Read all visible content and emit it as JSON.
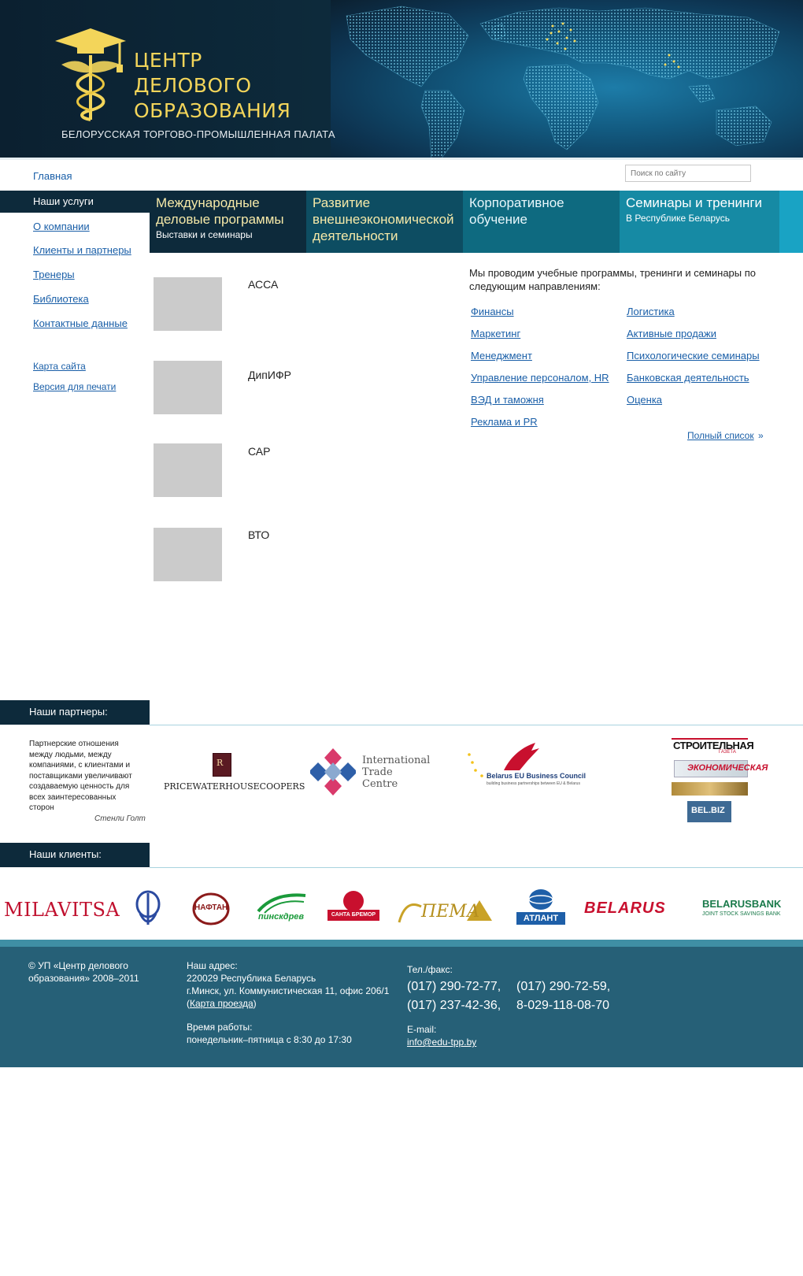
{
  "header": {
    "logo_line1": "ЦЕНТР",
    "logo_line2": "ДЕЛОВОГО",
    "logo_line3": "ОБРАЗОВАНИЯ",
    "subtitle": "БЕЛОРУССКАЯ ТОРГОВО-ПРОМЫШЛЕННАЯ ПАЛАТА"
  },
  "topbar": {
    "home_link": "Главная",
    "search_placeholder": "Поиск по сайту"
  },
  "sidebar": {
    "items": [
      {
        "label": "Наши услуги",
        "active": true
      },
      {
        "label": "О компании"
      },
      {
        "label": "Клиенты и партнеры"
      },
      {
        "label": "Тренеры"
      },
      {
        "label": "Библиотека"
      },
      {
        "label": "Контактные данные"
      }
    ],
    "secondary": [
      {
        "label": "Карта сайта"
      },
      {
        "label": "Версия для печати"
      }
    ]
  },
  "tabs": [
    {
      "title": "Международные деловые программы",
      "subtitle": "Выставки и семинары"
    },
    {
      "title": "Развитие внешнеэкономической деятельности",
      "subtitle": ""
    },
    {
      "title": "Корпоративное обучение",
      "subtitle": ""
    },
    {
      "title": "Семинары и тренинги",
      "subtitle": "В Республике Беларусь"
    }
  ],
  "programs": [
    {
      "label": "АССА"
    },
    {
      "label": "ДипИФР"
    },
    {
      "label": "САР"
    },
    {
      "label": "ВТО"
    }
  ],
  "directions": {
    "intro": "Мы проводим учебные программы, тренинги и семинары по следующим направлениям:",
    "left": [
      "Финансы",
      "Маркетинг",
      "Менеджмент",
      "Управление персоналом, HR",
      "ВЭД и таможня",
      "Реклама и PR"
    ],
    "right": [
      "Логистика",
      "Активные продажи",
      "Психологические семинары",
      "Банковская деятельность",
      "Оценка"
    ],
    "full_list": "Полный список",
    "full_list_arrow": "»"
  },
  "partners": {
    "heading": "Наши партнеры:",
    "quote": "Партнерские отношения между людьми, между компаниями, с клиентами и поставщиками увеличивают создаваемую ценность для всех заинтересованных сторон",
    "quote_author": "Стенли Голт",
    "logos": {
      "pwc": "PRICEWATERHOUSECOOPERS",
      "itc": [
        "International",
        "Trade",
        "Centre"
      ],
      "belarus_eu": "Belarus EU Business Council",
      "belarus_eu_sub": "building business partnerships between EU & Belarus",
      "stroitelnaya": "СТРОИТЕЛЬНАЯ",
      "stroitelnaya_sub": "ГАЗЕТА",
      "ekonomicheskaya": "ЭКОНОМИЧЕСКАЯ",
      "belbiz": "BEL.BIZ"
    }
  },
  "clients": {
    "heading": "Наши клиенты:",
    "logos": {
      "milavitsa": "MILAVITSA",
      "naftan": "НАФТАН",
      "pinskdrev": "пинскдрев",
      "santa": "САНТА БРЕМОР",
      "pema": "ПЕМА",
      "atlant": "АТЛАНТ",
      "belarus": "BELARUS",
      "belarusbank": "BELARUSBANK",
      "belarusbank_sub": "JOINT STOCK SAVINGS BANK"
    }
  },
  "footer": {
    "copyright_1": "© УП «Центр делового",
    "copyright_2": "образования» 2008–2011",
    "address_label": "Наш адрес:",
    "address_1": "220029 Республика Беларусь",
    "address_2": "г.Минск, ул. Коммунистическая 11, офис 206/1",
    "map_link": "Карта проезда",
    "hours_label": "Время работы:",
    "hours": "понедельник–пятница с 8:30 до 17:30",
    "phone_label": "Тел./факс:",
    "phones": [
      "(017) 290-72-77,",
      "(017) 290-72-59,",
      "(017) 237-42-36,",
      "8-029-118-08-70"
    ],
    "email_label": "E-mail:",
    "email": "info@edu-tpp.by"
  },
  "colors": {
    "header_bg": "#0d2a3b",
    "accent_gold": "#f3d55a",
    "link": "#1a5fa8",
    "footer_bg": "#266077"
  }
}
